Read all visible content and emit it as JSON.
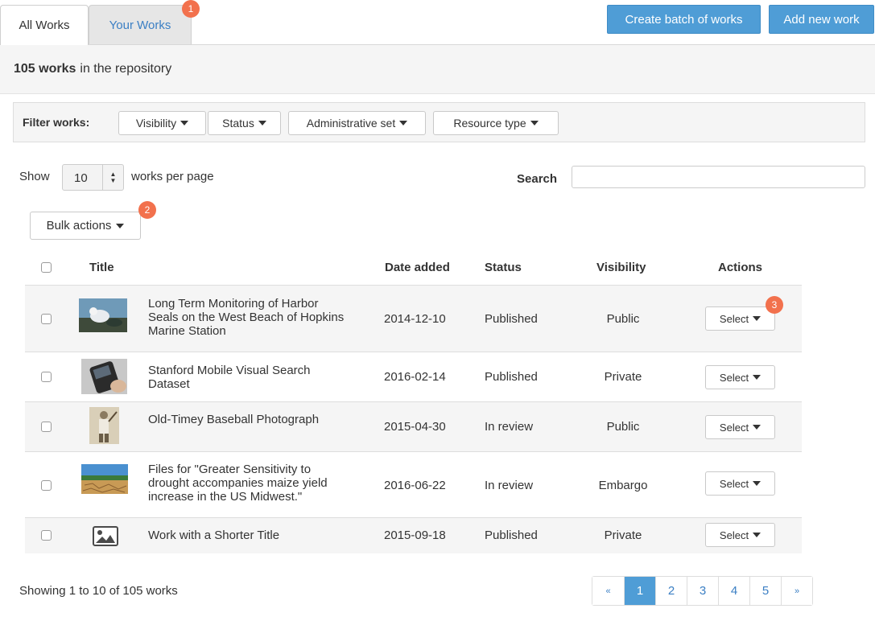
{
  "tabs": {
    "all_works": "All Works",
    "your_works": "Your Works",
    "your_works_badge": "1"
  },
  "actions": {
    "create_batch": "Create batch of works",
    "add_new": "Add new work"
  },
  "summary": {
    "count": "105 works",
    "suffix": "in the repository"
  },
  "filters": {
    "label": "Filter works:",
    "visibility": "Visibility",
    "status": "Status",
    "admin_set": "Administrative set",
    "resource_type": "Resource type"
  },
  "per_page": {
    "show": "Show",
    "value": "10",
    "suffix": "works per page"
  },
  "search": {
    "label": "Search",
    "value": ""
  },
  "bulk": {
    "label": "Bulk actions",
    "badge": "2"
  },
  "columns": {
    "title": "Title",
    "date_added": "Date added",
    "status": "Status",
    "visibility": "Visibility",
    "actions": "Actions"
  },
  "rows": [
    {
      "title_lines": [
        "Long Term Monitoring of Harbor",
        "Seals on the West Beach of Hopkins",
        "Marine Station"
      ],
      "date": "2014-12-10",
      "status": "Published",
      "visibility": "Public",
      "action": "Select",
      "thumb": "seal-photo"
    },
    {
      "title_lines": [
        "Stanford Mobile Visual Search",
        "Dataset"
      ],
      "date": "2016-02-14",
      "status": "Published",
      "visibility": "Private",
      "action": "Select",
      "thumb": "phone-photo"
    },
    {
      "title_lines": [
        "Old-Timey Baseball Photograph"
      ],
      "date": "2015-04-30",
      "status": "In review",
      "visibility": "Public",
      "action": "Select",
      "thumb": "baseball-photo"
    },
    {
      "title_lines": [
        "Files for \"Greater Sensitivity to",
        "drought accompanies maize yield",
        "increase in the US Midwest.\""
      ],
      "date": "2016-06-22",
      "status": "In review",
      "visibility": "Embargo",
      "action": "Select",
      "thumb": "drought-photo"
    },
    {
      "title_lines": [
        "Work with a Shorter Title"
      ],
      "date": "2015-09-18",
      "status": "Published",
      "visibility": "Private",
      "action": "Select",
      "thumb": "image-placeholder-icon"
    }
  ],
  "row_badge": "3",
  "footer": {
    "showing": "Showing 1 to 10 of 105 works"
  },
  "pagination": {
    "prev": "«",
    "pages": [
      "1",
      "2",
      "3",
      "4",
      "5"
    ],
    "next": "»",
    "active": "1"
  },
  "colors": {
    "primary": "#4f9dd6",
    "badge": "#f2714d",
    "link": "#3b7fc4"
  }
}
